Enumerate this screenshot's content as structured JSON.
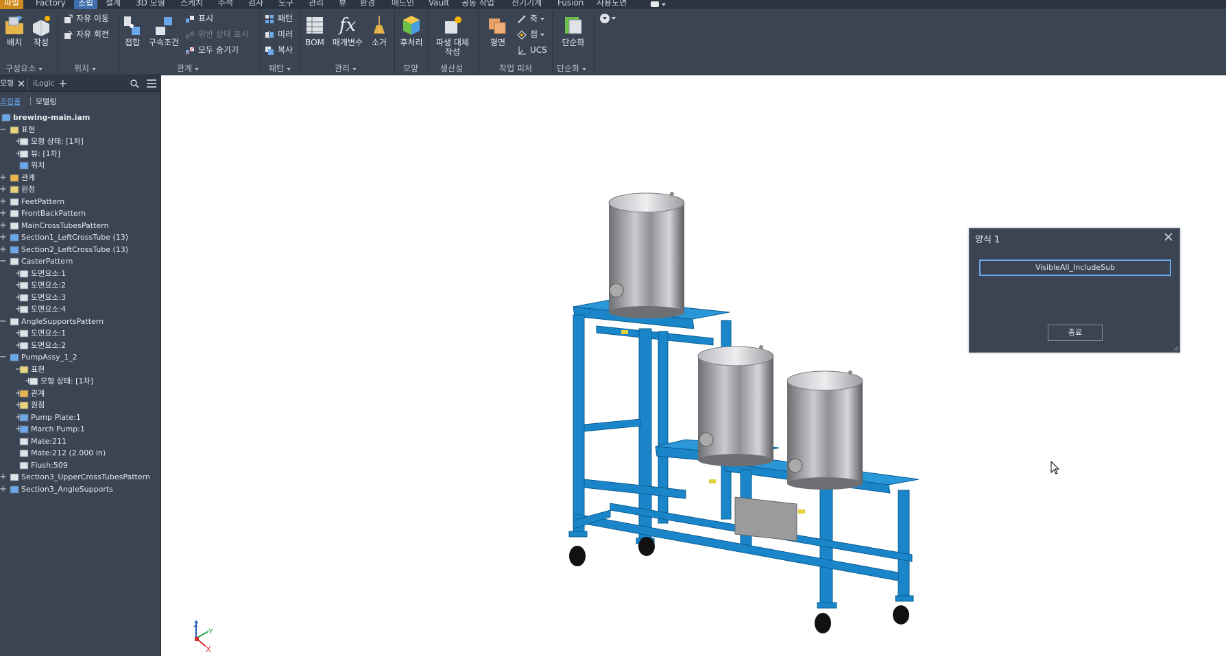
{
  "menubar": {
    "tabs": [
      "파일",
      "Factory",
      "조립",
      "설계",
      "3D 모형",
      "스케치",
      "주석",
      "검사",
      "도구",
      "관리",
      "뷰",
      "환경",
      "애드인",
      "Vault",
      "공동 작업",
      "전기기계",
      "Fusion",
      "사용노면"
    ],
    "active_tab": "조립"
  },
  "ribbon": {
    "groups": {
      "component": {
        "label": "구성요소",
        "place": "배치",
        "create": "작성"
      },
      "position": {
        "label": "위치",
        "free_move": "자유 이동",
        "free_rotate": "자유 회전"
      },
      "relation": {
        "label": "관계",
        "joint": "접합",
        "constrain": "구속조건",
        "show": "표시",
        "show_sick": "위반 상태 표시",
        "hide_all": "모두 숨기기"
      },
      "pattern": {
        "label": "패턴",
        "pattern": "패턴",
        "mirror": "미러",
        "copy": "복사"
      },
      "manage": {
        "label": "관리",
        "bom": "BOM",
        "parameters": "매개변수",
        "purge": "소거"
      },
      "appearance": {
        "label": "모양",
        "post": "후처리"
      },
      "productivity": {
        "label": "생산성",
        "derive_l1": "파생 대체",
        "derive_l2": "작성"
      },
      "work_features": {
        "label": "작업 피처",
        "plane": "평면",
        "axis": "축",
        "point": "점",
        "ucs": "UCS"
      },
      "simplification": {
        "label": "단순화",
        "simplify": "단순화"
      }
    }
  },
  "browser": {
    "tabs": [
      "모형",
      "iLogic"
    ],
    "subtabs": [
      "조립품",
      "모델링"
    ],
    "tree": [
      {
        "label": "brewing-main.iam",
        "bold": true,
        "level": 0,
        "icon": "assembly-icon",
        "exp": ""
      },
      {
        "label": "표현",
        "level": 1,
        "icon": "folder-icon",
        "exp": "−"
      },
      {
        "label": "모형 상태: [1차]",
        "level": 2,
        "icon": "model-state-icon",
        "exp": "+"
      },
      {
        "label": "뷰: [1차]",
        "level": 2,
        "icon": "view-icon",
        "exp": "+"
      },
      {
        "label": "위치",
        "level": 2,
        "icon": "position-icon",
        "exp": ""
      },
      {
        "label": "관계",
        "level": 1,
        "icon": "relations-icon",
        "exp": "+"
      },
      {
        "label": "원점",
        "level": 1,
        "icon": "origin-icon",
        "exp": "+"
      },
      {
        "label": "FeetPattern",
        "level": 1,
        "icon": "pattern-icon",
        "exp": "+"
      },
      {
        "label": "FrontBackPattern",
        "level": 1,
        "icon": "pattern-icon",
        "exp": "+"
      },
      {
        "label": "MainCrossTubesPattern",
        "level": 1,
        "icon": "pattern-icon",
        "exp": "+"
      },
      {
        "label": "Section1_LeftCrossTube (13)",
        "level": 1,
        "icon": "part-icon",
        "exp": "+"
      },
      {
        "label": "Section2_LeftCrossTube (13)",
        "level": 1,
        "icon": "part-icon",
        "exp": "+"
      },
      {
        "label": "CasterPattern",
        "level": 1,
        "icon": "pattern-icon",
        "exp": "−"
      },
      {
        "label": "도면요소:1",
        "level": 2,
        "icon": "pattern-icon",
        "exp": "+"
      },
      {
        "label": "도면요소:2",
        "level": 2,
        "icon": "pattern-icon",
        "exp": "+"
      },
      {
        "label": "도면요소:3",
        "level": 2,
        "icon": "pattern-icon",
        "exp": "+"
      },
      {
        "label": "도면요소:4",
        "level": 2,
        "icon": "pattern-icon",
        "exp": "+"
      },
      {
        "label": "AngleSupportsPattern",
        "level": 1,
        "icon": "pattern-icon",
        "exp": "−"
      },
      {
        "label": "도면요소:1",
        "level": 2,
        "icon": "pattern-icon",
        "exp": "+"
      },
      {
        "label": "도면요소:2",
        "level": 2,
        "icon": "pattern-icon",
        "exp": "+"
      },
      {
        "label": "PumpAssy_1_2",
        "level": 1,
        "icon": "subassembly-icon",
        "exp": "−"
      },
      {
        "label": "표현",
        "level": 2,
        "icon": "folder-icon",
        "exp": "−"
      },
      {
        "label": "모형 상태: [1차]",
        "level": 3,
        "icon": "model-state-icon",
        "exp": "+"
      },
      {
        "label": "관계",
        "level": 2,
        "icon": "relations-icon",
        "exp": "+"
      },
      {
        "label": "원점",
        "level": 2,
        "icon": "origin-icon",
        "exp": "+"
      },
      {
        "label": "Pump Plate:1",
        "level": 2,
        "icon": "part-icon",
        "exp": "+"
      },
      {
        "label": "March Pump:1",
        "level": 2,
        "icon": "part-icon",
        "exp": "+"
      },
      {
        "label": "Mate:211",
        "level": 2,
        "icon": "mate-icon",
        "exp": ""
      },
      {
        "label": "Mate:212 (2.000 in)",
        "level": 2,
        "icon": "mate-icon",
        "exp": ""
      },
      {
        "label": "Flush:509",
        "level": 2,
        "icon": "mate-icon",
        "exp": ""
      },
      {
        "label": "Section3_UpperCrossTubesPattern",
        "level": 1,
        "icon": "pattern-icon",
        "exp": "+"
      },
      {
        "label": "Section3_AngleSupports",
        "level": 1,
        "icon": "subassembly-icon",
        "exp": "+"
      }
    ]
  },
  "dialog": {
    "title": "양식 1",
    "field_value": "VisibleAll_IncludeSub",
    "button": "종료"
  },
  "viewcube": {
    "z": "Z",
    "y": "Y",
    "x": "X"
  },
  "colors": {
    "frame_blue": "#1a86c9",
    "ribbon_bg": "#3b4453",
    "menubar_bg": "#2c3442",
    "accent": "#3f6fae"
  }
}
